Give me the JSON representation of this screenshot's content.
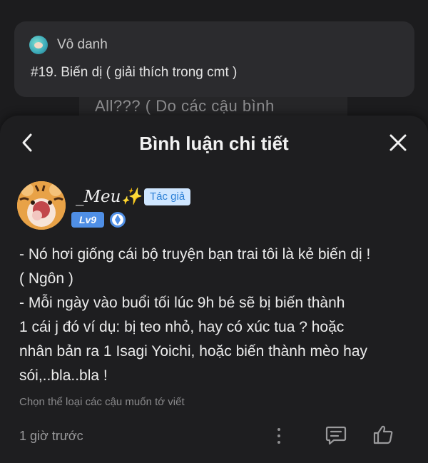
{
  "background_post": {
    "author": "Vô danh",
    "title": "#19. Biến dị ( giải thích trong cmt )",
    "peek_text": "All??? ( Do các cậu bình"
  },
  "sheet": {
    "title": "Bình luận chi tiết",
    "back_icon": "chevron-left-icon",
    "close_icon": "close-icon"
  },
  "comment": {
    "username": "_Meu✨",
    "author_badge": "Tác giả",
    "level_badge": "Lv9",
    "lines": [
      "- Nó hơi giống cái bộ truyện bạn trai tôi là kẻ biến dị !",
      "( Ngôn )",
      "- Mỗi ngày vào buổi tối lúc 9h bé sẽ bị biến thành",
      "1 cái j đó ví dụ: bị teo nhỏ, hay có xúc tua ? hoặc",
      "nhân bản ra 1 Isagi Yoichi, hoặc biến thành mèo hay",
      "sói,..bla..bla !"
    ],
    "prompt": "Chọn thể loại các cậu muốn tớ viết",
    "time": "1 giờ trước"
  },
  "colors": {
    "sheet_bg": "#1e1e20",
    "card_bg": "#2b2b2e",
    "badge_bg": "#cfe6ff",
    "badge_text": "#2a7fd6",
    "level_bg": "#4f8fe6"
  }
}
